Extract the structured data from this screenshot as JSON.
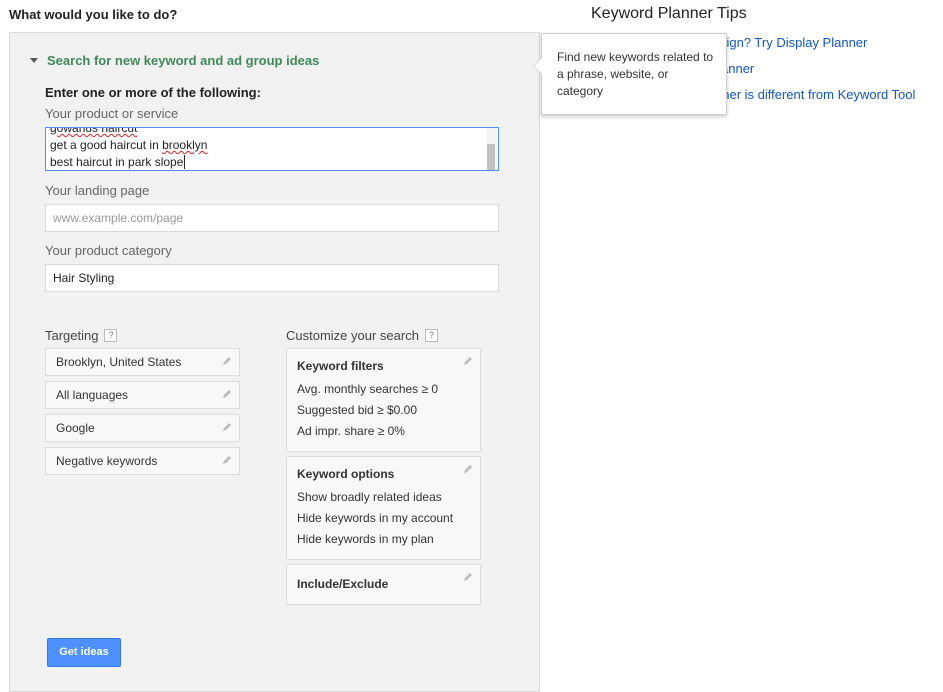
{
  "page": {
    "heading": "What would you like to do?"
  },
  "section": {
    "toggle_label": "Search for new keyword and ad group ideas",
    "enter_label": "Enter one or more of the following:"
  },
  "product": {
    "label": "Your product or service",
    "lines": [
      "gowanus haircut",
      "get a good haircut in ",
      "best haircut in park slope"
    ],
    "spell_word": "brooklyn"
  },
  "landing": {
    "label": "Your landing page",
    "placeholder": "www.example.com/page"
  },
  "category": {
    "label": "Your product category",
    "value": "Hair Styling"
  },
  "targeting": {
    "label": "Targeting",
    "help": "?",
    "items": [
      "Brooklyn, United States",
      "All languages",
      "Google",
      "Negative keywords"
    ]
  },
  "customize": {
    "label": "Customize your search",
    "help": "?",
    "filters": {
      "title": "Keyword filters",
      "items": [
        "Avg. monthly searches ≥ 0",
        "Suggested bid ≥ $0.00",
        "Ad impr. share ≥ 0%"
      ]
    },
    "options": {
      "title": "Keyword options",
      "items": [
        "Show broadly related ideas",
        "Hide keywords in my account",
        "Hide keywords in my plan"
      ]
    },
    "include_exclude": {
      "title": "Include/Exclude"
    }
  },
  "actions": {
    "get_ideas": "Get ideas"
  },
  "tips": {
    "title": "Keyword Planner Tips",
    "links": [
      "paign? Try Display Planner",
      "anner",
      "nner is different from Keyword Tool"
    ]
  },
  "tooltip": {
    "text": "Find new keywords related to a phrase, website, or category"
  },
  "colors": {
    "accent_green": "#3d8a57",
    "link_blue": "#1155cc",
    "button_blue": "#4d90fe"
  }
}
